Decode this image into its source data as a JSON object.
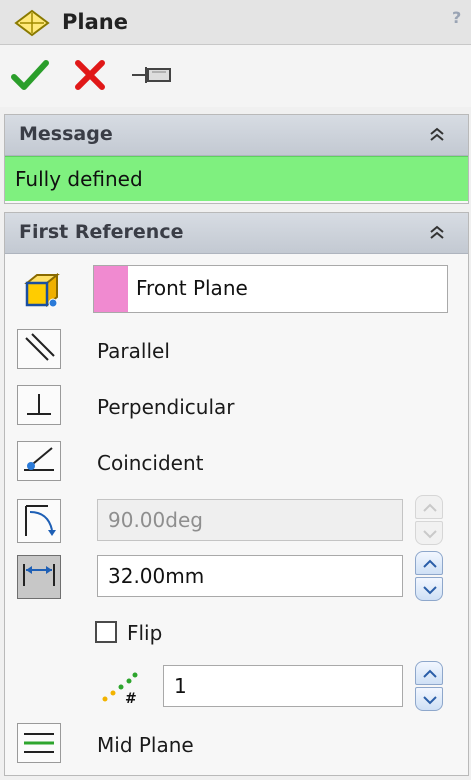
{
  "window": {
    "title": "Plane",
    "help_glyph": "?"
  },
  "actions": [
    {
      "icon": "check-icon"
    },
    {
      "icon": "close-icon"
    },
    {
      "icon": "pushpin-icon"
    }
  ],
  "message_panel": {
    "header": "Message",
    "status": "Fully defined",
    "status_color": "#7ff07f"
  },
  "first_reference": {
    "header": "First Reference",
    "selection": "Front Plane",
    "selection_color": "#f08ad0",
    "options": {
      "parallel": "Parallel",
      "perpendicular": "Perpendicular",
      "coincident": "Coincident"
    },
    "angle": {
      "value": "90.00deg",
      "enabled": false
    },
    "distance": {
      "value": "32.00mm",
      "enabled": true
    },
    "flip_label": "Flip",
    "flip_checked": false,
    "instances": "1",
    "mid_plane": "Mid Plane"
  }
}
